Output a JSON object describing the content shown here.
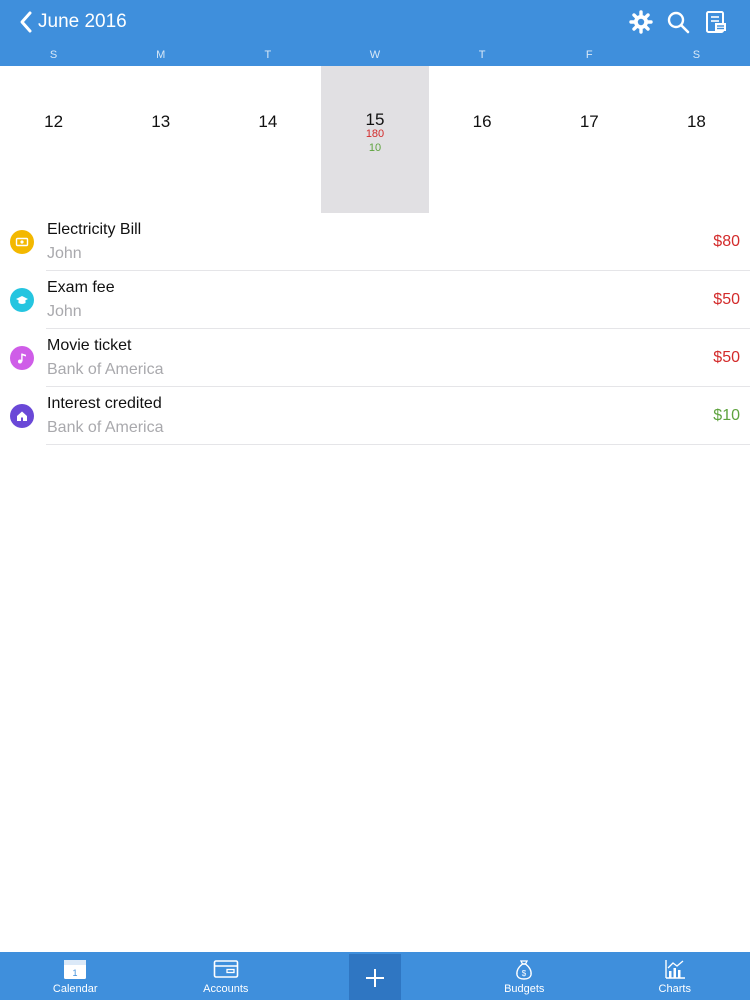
{
  "header": {
    "title": "June 2016",
    "icons": [
      "chevron-left-icon",
      "gear-icon",
      "search-icon",
      "report-icon"
    ]
  },
  "week": {
    "weekday_labels": [
      "S",
      "M",
      "T",
      "W",
      "T",
      "F",
      "S"
    ],
    "days": [
      {
        "date": "12"
      },
      {
        "date": "13"
      },
      {
        "date": "14"
      },
      {
        "date": "15",
        "expense": "180",
        "income": "10",
        "selected": true
      },
      {
        "date": "16"
      },
      {
        "date": "17"
      },
      {
        "date": "18"
      }
    ]
  },
  "transactions": [
    {
      "name": "Electricity Bill",
      "account": "John",
      "amount": "$80",
      "type": "expense",
      "icon": "bill-icon",
      "icon_color": "#f3b800"
    },
    {
      "name": "Exam fee",
      "account": "John",
      "amount": "$50",
      "type": "expense",
      "icon": "graduation-cap-icon",
      "icon_color": "#25c5e0"
    },
    {
      "name": "Movie ticket",
      "account": "Bank of America",
      "amount": "$50",
      "type": "expense",
      "icon": "music-note-icon",
      "icon_color": "#cf5de8"
    },
    {
      "name": "Interest credited",
      "account": "Bank of America",
      "amount": "$10",
      "type": "income",
      "icon": "house-icon",
      "icon_color": "#6a48d7"
    }
  ],
  "tabbar": {
    "calendar": "Calendar",
    "accounts": "Accounts",
    "budgets": "Budgets",
    "charts": "Charts"
  },
  "colors": {
    "header": "#3f8fdc",
    "expense": "#d32b2b",
    "income": "#5ea33e",
    "selected_day": "#e1e0e3"
  }
}
